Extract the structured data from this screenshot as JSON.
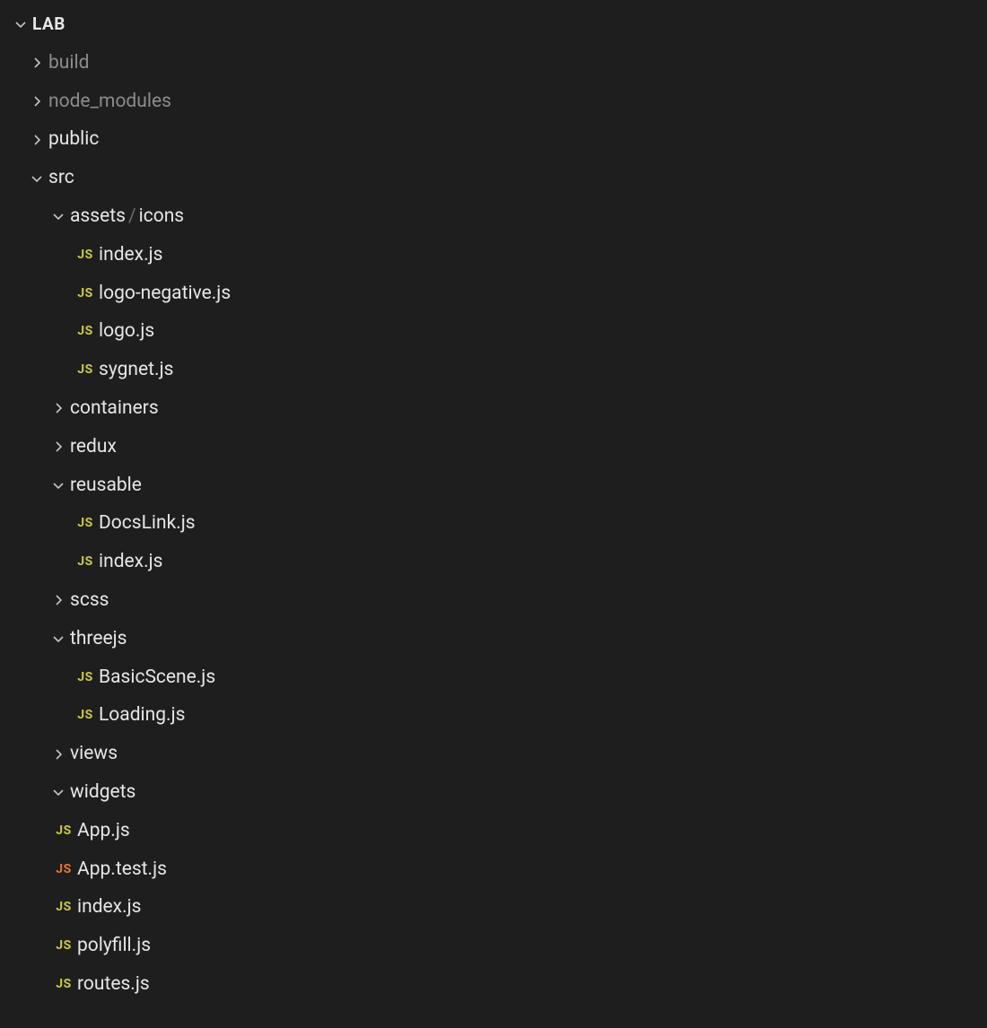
{
  "root_label": "LAB",
  "icon_text": {
    "js": "JS",
    "testjs": "JS"
  },
  "nodes": [
    {
      "kind": "root",
      "depth": 0,
      "open": true,
      "label": "LAB"
    },
    {
      "kind": "folder",
      "depth": 1,
      "open": false,
      "label": "build",
      "dim": true
    },
    {
      "kind": "folder",
      "depth": 1,
      "open": false,
      "label": "node_modules",
      "dim": true
    },
    {
      "kind": "folder",
      "depth": 1,
      "open": false,
      "label": "public"
    },
    {
      "kind": "folder",
      "depth": 1,
      "open": true,
      "label": "src"
    },
    {
      "kind": "folder",
      "depth": 2,
      "open": true,
      "label": "assets",
      "suffix": "icons"
    },
    {
      "kind": "file",
      "depth": 3,
      "icon": "js",
      "label": "index.js"
    },
    {
      "kind": "file",
      "depth": 3,
      "icon": "js",
      "label": "logo-negative.js"
    },
    {
      "kind": "file",
      "depth": 3,
      "icon": "js",
      "label": "logo.js"
    },
    {
      "kind": "file",
      "depth": 3,
      "icon": "js",
      "label": "sygnet.js"
    },
    {
      "kind": "folder",
      "depth": 2,
      "open": false,
      "label": "containers"
    },
    {
      "kind": "folder",
      "depth": 2,
      "open": false,
      "label": "redux"
    },
    {
      "kind": "folder",
      "depth": 2,
      "open": true,
      "label": "reusable"
    },
    {
      "kind": "file",
      "depth": 3,
      "icon": "js",
      "label": "DocsLink.js"
    },
    {
      "kind": "file",
      "depth": 3,
      "icon": "js",
      "label": "index.js"
    },
    {
      "kind": "folder",
      "depth": 2,
      "open": false,
      "label": "scss"
    },
    {
      "kind": "folder",
      "depth": 2,
      "open": true,
      "label": "threejs"
    },
    {
      "kind": "file",
      "depth": 3,
      "icon": "js",
      "label": "BasicScene.js"
    },
    {
      "kind": "file",
      "depth": 3,
      "icon": "js",
      "label": "Loading.js"
    },
    {
      "kind": "folder",
      "depth": 2,
      "open": false,
      "label": "views"
    },
    {
      "kind": "folder",
      "depth": 2,
      "open": true,
      "label": "widgets"
    },
    {
      "kind": "file",
      "depth": 2,
      "icon": "js",
      "label": "App.js"
    },
    {
      "kind": "file",
      "depth": 2,
      "icon": "testjs",
      "label": "App.test.js"
    },
    {
      "kind": "file",
      "depth": 2,
      "icon": "js",
      "label": "index.js"
    },
    {
      "kind": "file",
      "depth": 2,
      "icon": "js",
      "label": "polyfill.js"
    },
    {
      "kind": "file",
      "depth": 2,
      "icon": "js",
      "label": "routes.js"
    }
  ]
}
